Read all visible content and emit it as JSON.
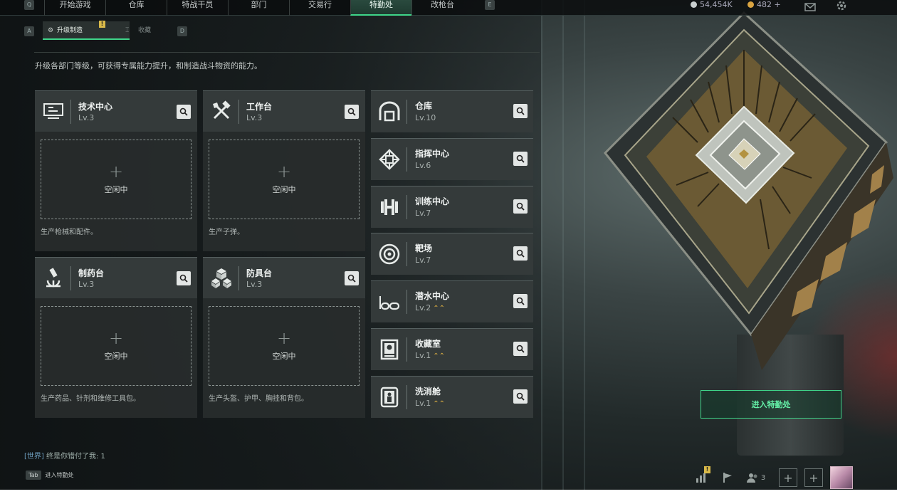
{
  "nav": {
    "key_left": "Q",
    "key_right": "E",
    "tabs": [
      "开始游戏",
      "仓库",
      "特战干员",
      "部门",
      "交易行",
      "特勤处",
      "改枪台"
    ],
    "active_tab": "特勤处",
    "currency_primary": "54,454K",
    "currency_secondary": "482 +"
  },
  "subnav": {
    "key_left": "A",
    "key_right": "D",
    "active_label": "升级制造",
    "inactive_label": "收藏",
    "warn_mark": "!"
  },
  "description": "升级各部门等级，可获得专属能力提升，和制造战斗物资的能力。",
  "big_cards": [
    {
      "name": "技术中心",
      "level": "Lv.3",
      "slot_label": "空闲中",
      "desc": "生产枪械和配件。",
      "icon": "computer-icon"
    },
    {
      "name": "工作台",
      "level": "Lv.3",
      "slot_label": "空闲中",
      "desc": "生产子弹。",
      "icon": "tools-icon"
    },
    {
      "name": "制药台",
      "level": "Lv.3",
      "slot_label": "空闲中",
      "desc": "生产药品、针剂和维修工具包。",
      "icon": "microscope-icon"
    },
    {
      "name": "防具台",
      "level": "Lv.3",
      "slot_label": "空闲中",
      "desc": "生产头盔、护甲、胸挂和背包。",
      "icon": "cubes-icon"
    }
  ],
  "small_cards": [
    {
      "name": "仓库",
      "level": "Lv.10",
      "upgrade": false,
      "icon": "warehouse-icon"
    },
    {
      "name": "指挥中心",
      "level": "Lv.6",
      "upgrade": false,
      "icon": "chip-icon"
    },
    {
      "name": "训练中心",
      "level": "Lv.7",
      "upgrade": false,
      "icon": "dumbbell-icon"
    },
    {
      "name": "靶场",
      "level": "Lv.7",
      "upgrade": false,
      "icon": "target-icon"
    },
    {
      "name": "潜水中心",
      "level": "Lv.2",
      "upgrade": true,
      "icon": "goggles-icon"
    },
    {
      "name": "收藏室",
      "level": "Lv.1",
      "upgrade": true,
      "icon": "display-case-icon"
    },
    {
      "name": "洗消舱",
      "level": "Lv.1",
      "upgrade": true,
      "icon": "capsule-icon"
    }
  ],
  "upgrade_glyph": "⌃⌃",
  "enter_button": "进入特勤处",
  "chat": {
    "channel": "[世界]",
    "message": "终是你错付了我: 1"
  },
  "tab_hint": {
    "key": "Tab",
    "label": "进入特勤处"
  },
  "bottom": {
    "friends_count": "3",
    "alert_mark": "!"
  },
  "colors": {
    "accent": "#3fd68a",
    "upgrade": "#e3b443",
    "card_bg": "#343a3a"
  }
}
